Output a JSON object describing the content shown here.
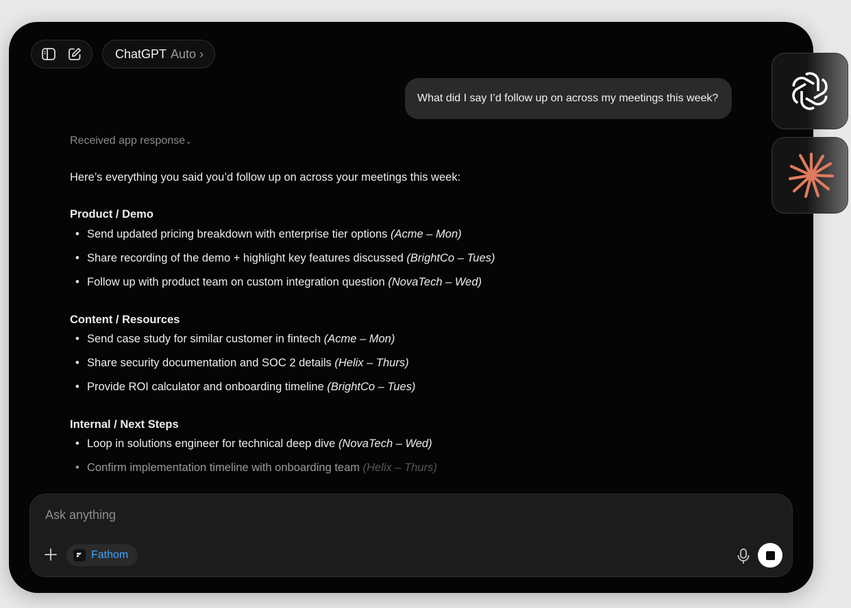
{
  "header": {
    "model_name": "ChatGPT",
    "model_mode": "Auto",
    "model_chevron": "›"
  },
  "conversation": {
    "user_message": "What did I say I’d follow up on across my meetings this week?",
    "received_label": "Received app response",
    "received_chevron": "⌄",
    "intro": "Here’s everything you said you’d follow up on across your meetings this week:",
    "sections": [
      {
        "title": "Product / Demo",
        "items": [
          {
            "text": "Send updated pricing breakdown with enterprise tier options",
            "meta": "(Acme – Mon)"
          },
          {
            "text": "Share recording of the demo + highlight key features discussed",
            "meta": "(BrightCo – Tues)"
          },
          {
            "text": "Follow up with product team on custom integration question",
            "meta": "(NovaTech – Wed)"
          }
        ]
      },
      {
        "title": "Content / Resources",
        "items": [
          {
            "text": "Send case study for similar customer in fintech",
            "meta": "(Acme – Mon)"
          },
          {
            "text": "Share security documentation and SOC 2 details",
            "meta": "(Helix – Thurs)"
          },
          {
            "text": "Provide ROI calculator and onboarding timeline",
            "meta": "(BrightCo – Tues)"
          }
        ]
      },
      {
        "title": "Internal / Next Steps",
        "items": [
          {
            "text": "Loop in solutions engineer for technical deep dive",
            "meta": "(NovaTech – Wed)"
          },
          {
            "text": "Confirm implementation timeline with onboarding team",
            "meta": "(Helix – Thurs)"
          }
        ]
      }
    ],
    "bullet": "•"
  },
  "composer": {
    "placeholder": "Ask anything",
    "app_chip_label": "Fathom"
  },
  "icons": {
    "sidebar": "sidebar-toggle-icon",
    "new_chat": "compose-icon",
    "plus": "plus-icon",
    "mic": "microphone-icon",
    "stop": "stop-icon",
    "openai": "openai-logo-icon",
    "claude": "claude-starburst-icon",
    "fathom": "fathom-logo-icon"
  },
  "colors": {
    "background": "#050505",
    "user_bubble": "#2a2a2a",
    "fathom_accent": "#3ba7ff",
    "claude_accent": "#e07a5f"
  }
}
